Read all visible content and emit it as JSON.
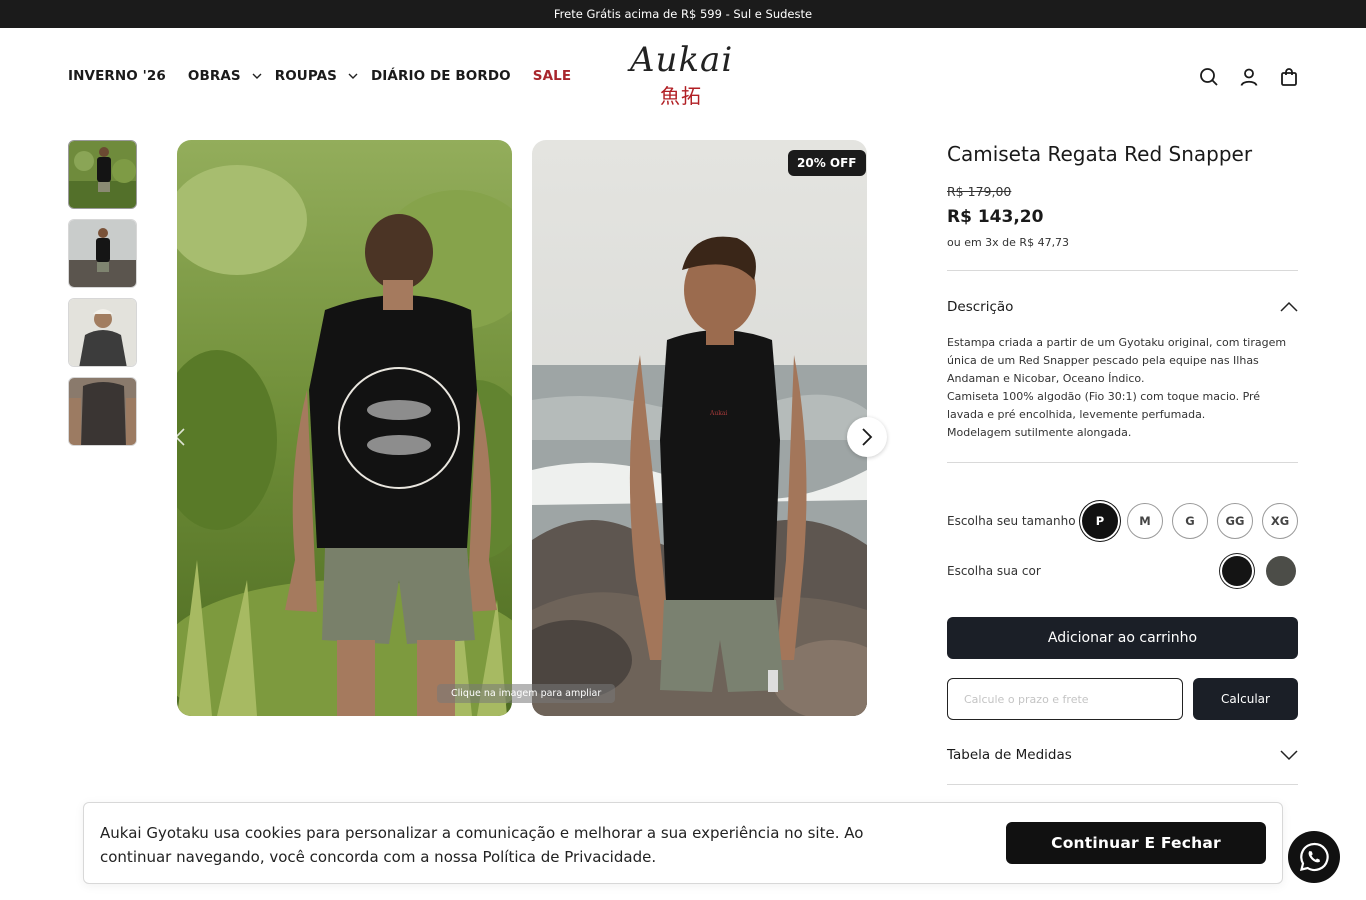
{
  "announcement": "Frete Grátis acima de R$ 599 - Sul e Sudeste",
  "nav": {
    "items": [
      {
        "label": "INVERNO '26"
      },
      {
        "label": "OBRAS"
      },
      {
        "label": "ROUPAS"
      },
      {
        "label": "DIÁRIO DE BORDO"
      },
      {
        "label": "SALE"
      }
    ]
  },
  "logo": {
    "script": "Aukai",
    "kanji": "魚拓"
  },
  "header_icons": [
    "search-icon",
    "user-icon",
    "bag-icon"
  ],
  "gallery": {
    "discount_badge": "20% OFF",
    "zoom_hint_strong": "Clique na imagem",
    "zoom_hint_rest": " para ampliar"
  },
  "product": {
    "title": "Camiseta Regata Red Snapper",
    "old_price": "R$ 179,00",
    "price": "R$ 143,20",
    "installments": "ou em 3x de R$ 47,73",
    "description_title": "Descrição",
    "description_lines": [
      "Estampa criada a partir de um Gyotaku original, com tiragem única de um Red Snapper pescado pela equipe nas Ilhas Andaman e Nicobar, Oceano Índico.",
      "Camiseta 100% algodão (Fio 30:1) com toque macio. Pré lavada e pré encolhida, levemente perfumada.",
      "Modelagem sutilmente alongada."
    ],
    "size_label": "Escolha seu tamanho",
    "sizes": [
      "P",
      "M",
      "G",
      "GG",
      "XG"
    ],
    "selected_size": "P",
    "color_label": "Escolha sua cor",
    "colors": [
      "#141414",
      "#4c4d48"
    ],
    "add_to_cart": "Adicionar ao carrinho",
    "shipping_placeholder": "Calcule o prazo e frete",
    "calculate": "Calcular",
    "size_table": "Tabela de Medidas"
  },
  "cookie": {
    "text": "Aukai Gyotaku usa cookies para personalizar a comunicação e melhorar a sua experiência no site. Ao continuar navegando, você concorda com a nossa Política de Privacidade.",
    "button": "Continuar E Fechar"
  }
}
